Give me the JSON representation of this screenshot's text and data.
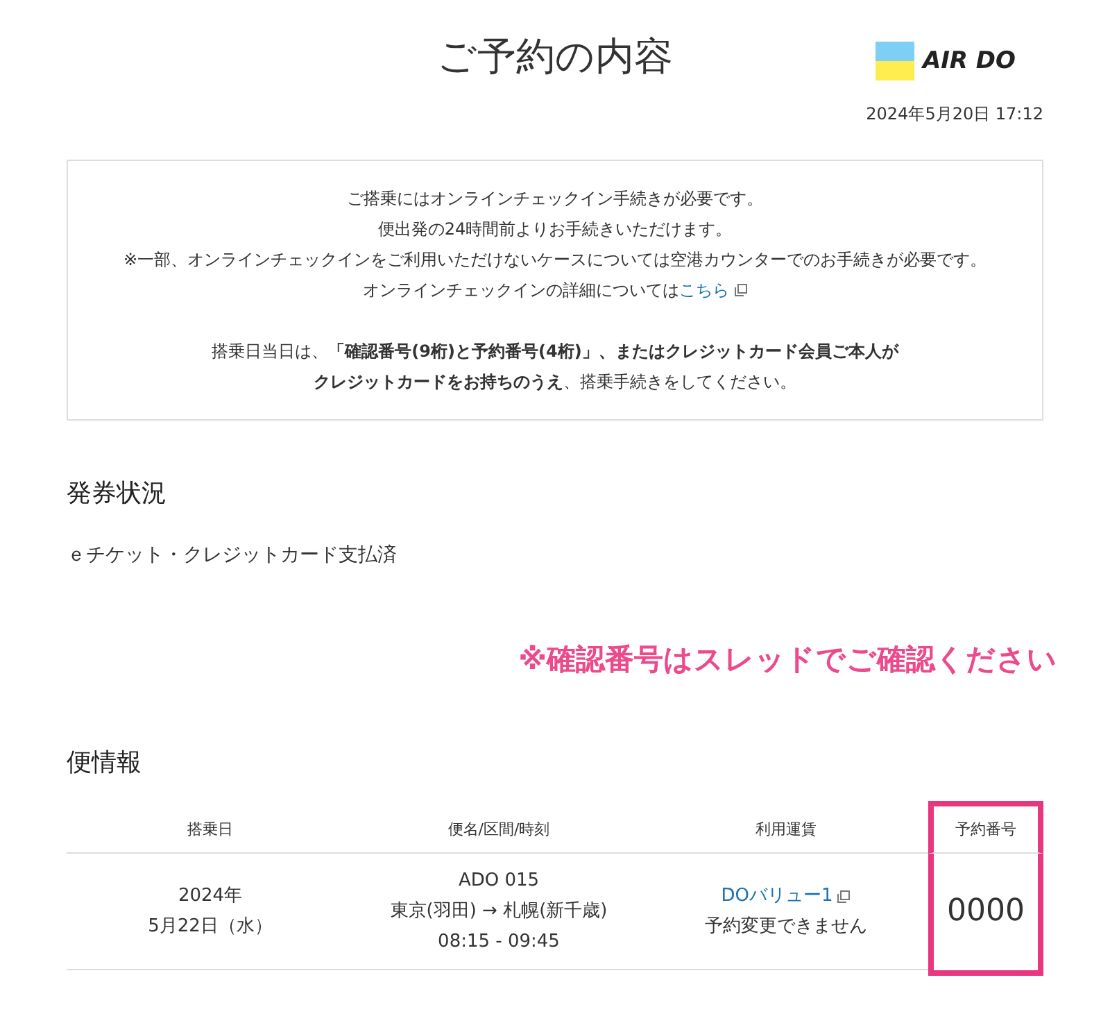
{
  "header": {
    "title": "ご予約の内容",
    "logo_text": "AIR DO",
    "timestamp": "2024年5月20日 17:12"
  },
  "notice": {
    "lines": [
      {
        "text": "ご搭乗にはオンラインチェックイン手続きが必要です。"
      },
      {
        "text": "便出発の24時間前よりお手続きいただけます。"
      },
      {
        "text": "※一部、オンラインチェックインをご利用いただけないケースについては空港カウンターでのお手続きが必要です。"
      },
      {
        "text": "オンラインチェックインの詳細については",
        "link": "こちら"
      }
    ],
    "emphasis_lines": [
      "搭乗日当日は、**「確認番号(9桁)と予約番号(4桁)」、またはクレジットカード会員ご本人が**",
      "**クレジットカードをお持ちのうえ**、搭乗手続きをしてください。"
    ]
  },
  "ticket_status": {
    "heading": "発券状況",
    "value": "ｅチケット・クレジットカード支払済"
  },
  "annotation": "※確認番号はスレッドでご確認ください",
  "flight_info": {
    "heading": "便情報",
    "columns": [
      {
        "label": "搭乗日",
        "highlighted": false
      },
      {
        "label": "便名/区間/時刻",
        "highlighted": false
      },
      {
        "label": "利用運賃",
        "highlighted": false
      },
      {
        "label": "予約番号",
        "highlighted": true
      }
    ],
    "rows": [
      {
        "date": [
          "2024年",
          "5月22日（水）"
        ],
        "flight": [
          "ADO 015",
          "東京(羽田) → 札幌(新千歳)",
          "08:15 - 09:45"
        ],
        "fare_link": "DOバリュー1",
        "fare_note": "予約変更できません",
        "reservation_number": "0000"
      }
    ]
  }
}
